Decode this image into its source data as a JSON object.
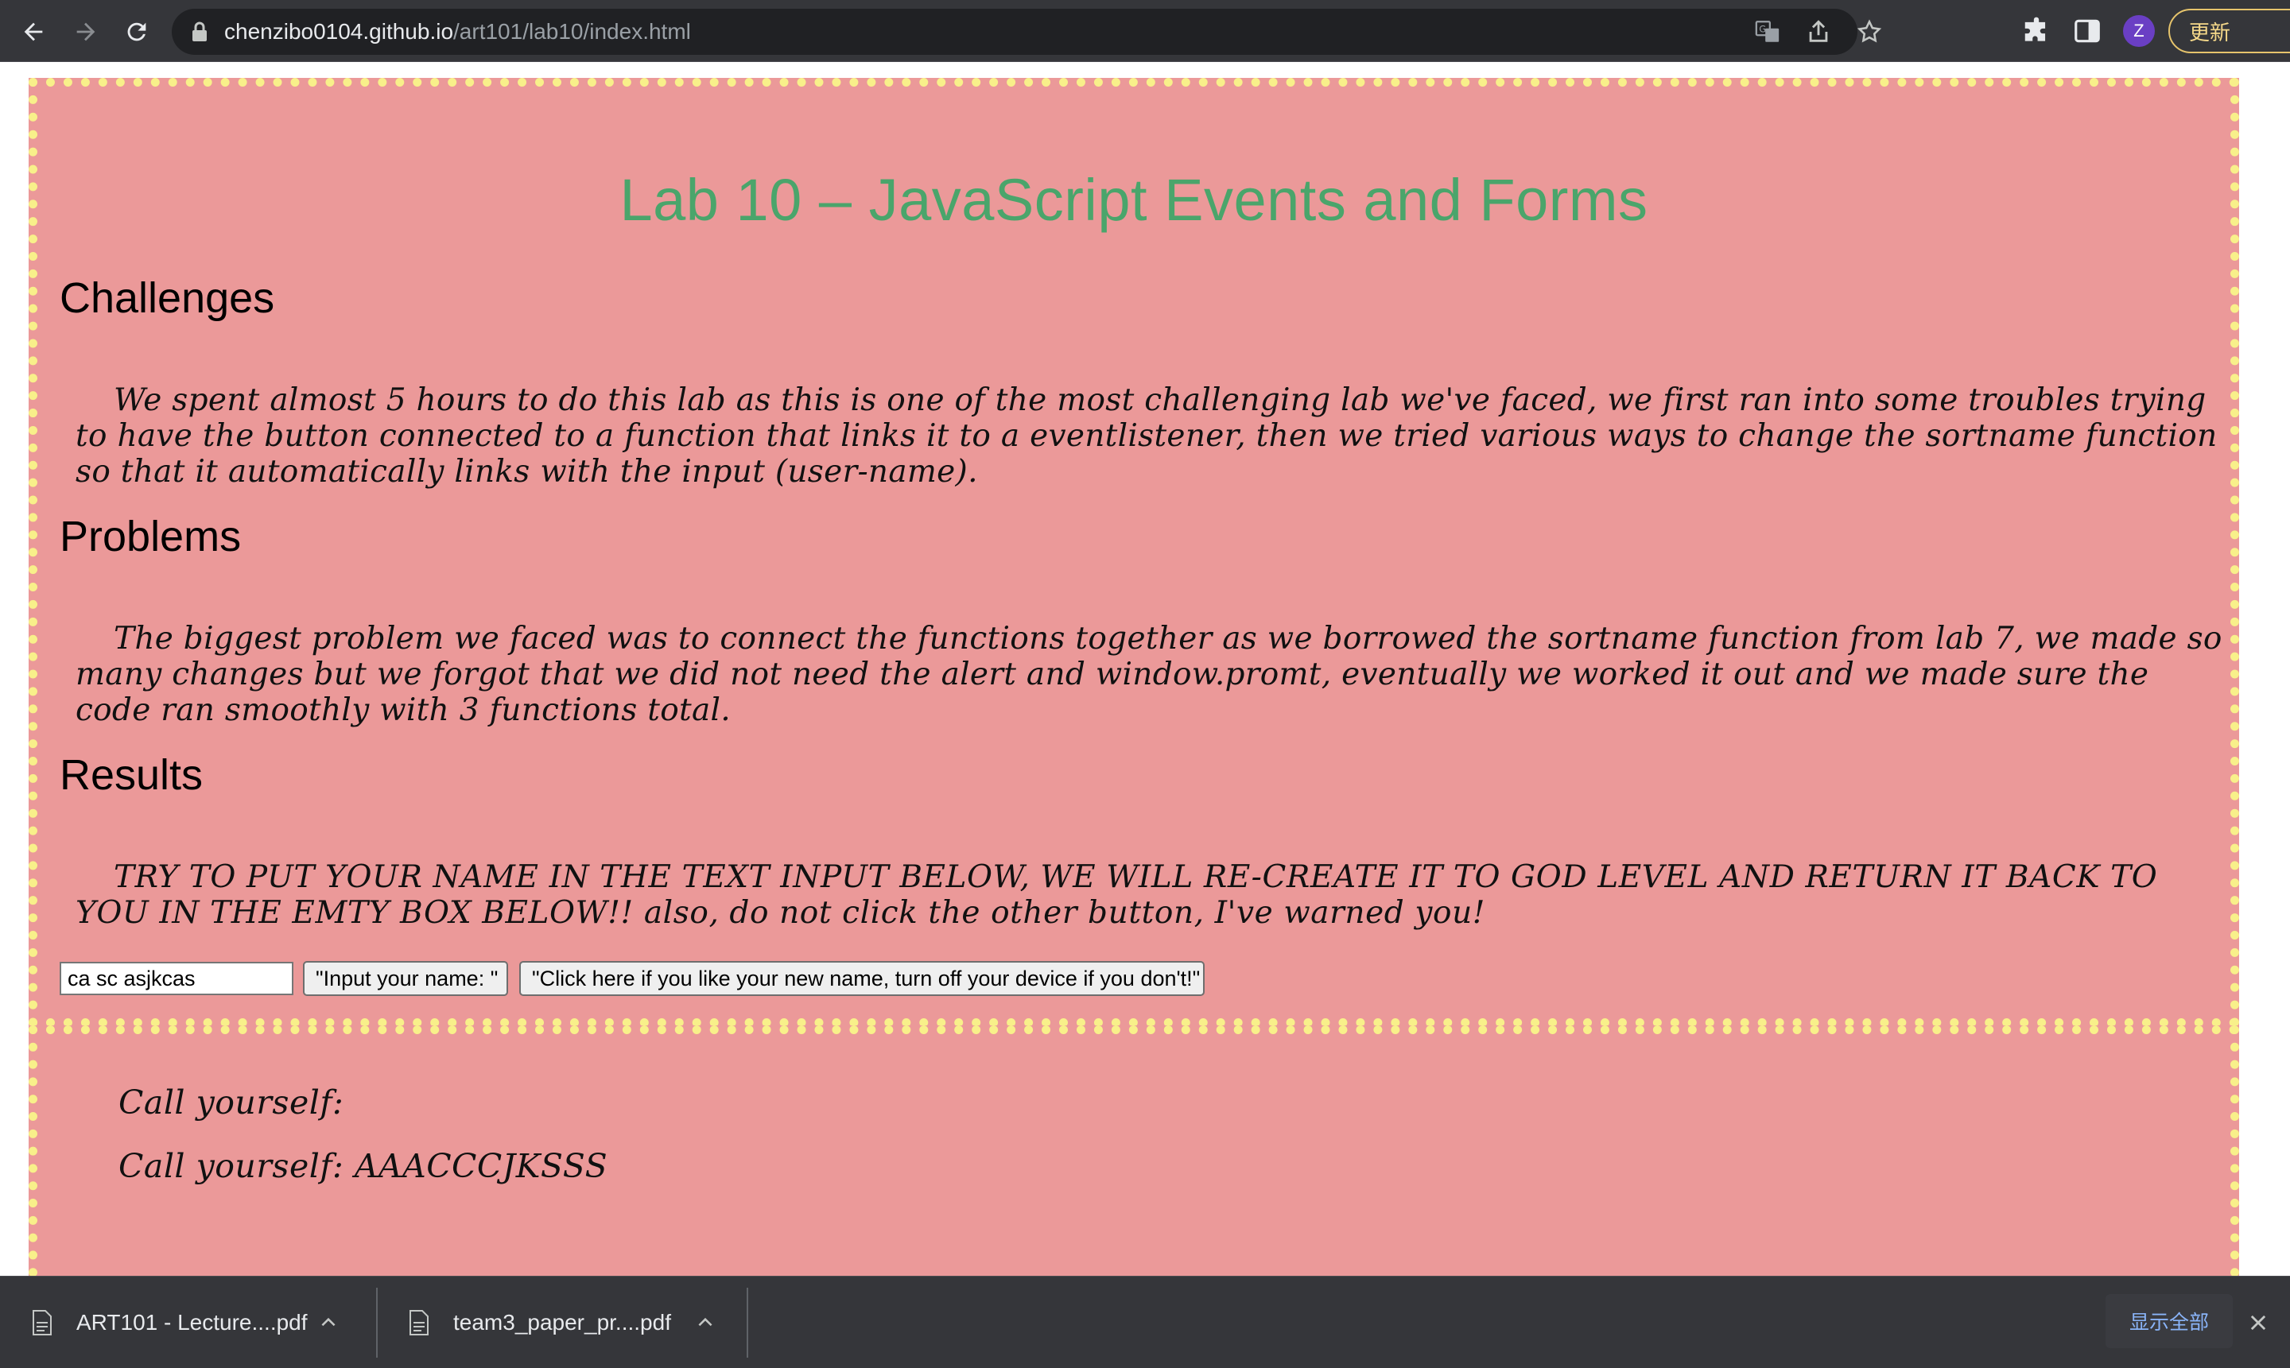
{
  "browser": {
    "url_host": "chenzibo0104.github.io",
    "url_path": "/art101/lab10/index.html",
    "profile_initial": "Z",
    "update_label": "更新",
    "accent_colors": {
      "toolbar": "#35363a",
      "omnibox": "#202124",
      "update_border": "#e6c46c",
      "avatar": "#6a3fc4"
    }
  },
  "page": {
    "title": "Lab 10 – JavaScript Events and Forms",
    "colors": {
      "panel_bg": "#eb9999",
      "panel_dots": "#f8f08a",
      "title": "#4aa56b"
    },
    "sections": {
      "challenges": {
        "heading": "Challenges",
        "text": "We spent almost 5 hours to do this lab as this is one of the most challenging lab we've faced, we first ran into some troubles trying to have the button connected to a function that links it to a eventlistener, then we tried various ways to change the sortname function so that it automatically links with the input (user-name)."
      },
      "problems": {
        "heading": "Problems",
        "text": "The biggest problem we faced was to connect the functions together as we borrowed the sortname function from lab 7, we made so many changes but we forgot that we did not need the alert and window.promt, eventually we worked it out and we made sure the code ran smoothly with 3 functions total."
      },
      "results": {
        "heading": "Results",
        "text": "TRY TO PUT YOUR NAME IN THE TEXT INPUT BELOW, WE WILL RE-CREATE IT TO GOD LEVEL AND RETURN IT BACK TO YOU IN THE EMTY BOX BELOW!! also, do not click the other button, I've warned you!"
      }
    },
    "form": {
      "name_value": "ca sc asjkcas",
      "input_button_label": "\"Input your name: \"",
      "other_button_label": "\"Click here if you like your new name, turn off your device if you don't!\""
    },
    "output": {
      "line1": "Call yourself:",
      "line2": "Call yourself: AAACCCJKSSS"
    }
  },
  "downloads": {
    "items": [
      {
        "name": "ART101 - Lecture....pdf"
      },
      {
        "name": "team3_paper_pr....pdf"
      }
    ],
    "show_all_label": "显示全部"
  }
}
